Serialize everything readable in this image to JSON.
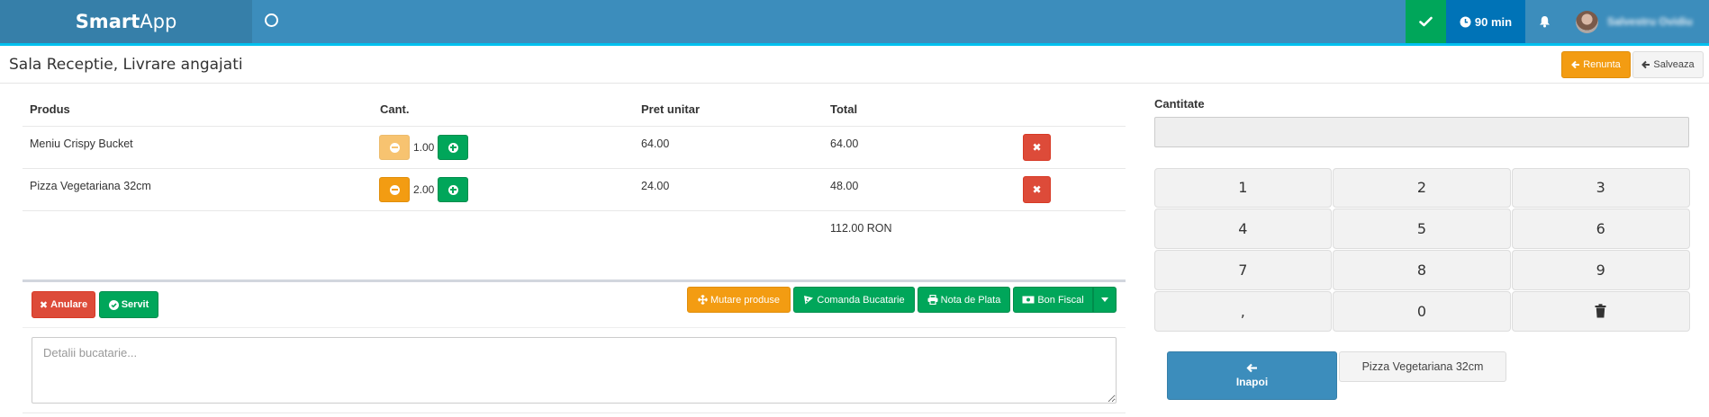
{
  "app": {
    "brand_bold": "Smart",
    "brand_rest": "App"
  },
  "topbar": {
    "timer": "90 min",
    "user_name": "Salvestru Ovidiu"
  },
  "page": {
    "title": "Sala Receptie, Livrare angajati"
  },
  "header_buttons": {
    "cancel": "Renunta",
    "save": "Salveaza"
  },
  "table": {
    "headers": {
      "product": "Produs",
      "qty": "Cant.",
      "unit_price": "Pret unitar",
      "total": "Total"
    },
    "rows": [
      {
        "product": "Meniu Crispy Bucket",
        "qty": "1.00",
        "unit_price": "64.00",
        "total": "64.00"
      },
      {
        "product": "Pizza Vegetariana 32cm",
        "qty": "2.00",
        "unit_price": "24.00",
        "total": "48.00"
      }
    ],
    "grand_total": "112.00 RON"
  },
  "actions": {
    "anulare": "Anulare",
    "servit": "Servit",
    "mutare": "Mutare produse",
    "comanda": "Comanda Bucatarie",
    "nota": "Nota de Plata",
    "bon": "Bon Fiscal"
  },
  "notes": {
    "placeholder": "Detalii bucatarie..."
  },
  "keypad": {
    "label": "Cantitate",
    "value": "",
    "keys": [
      "1",
      "2",
      "3",
      "4",
      "5",
      "6",
      "7",
      "8",
      "9",
      ",",
      "0"
    ],
    "back_label": "Inapoi",
    "selected_item": "Pizza Vegetariana 32cm"
  },
  "colors": {
    "primary": "#3c8dbc",
    "success": "#00a65a",
    "warning": "#f39c12",
    "danger": "#dd4b39",
    "info": "#0073b7"
  }
}
